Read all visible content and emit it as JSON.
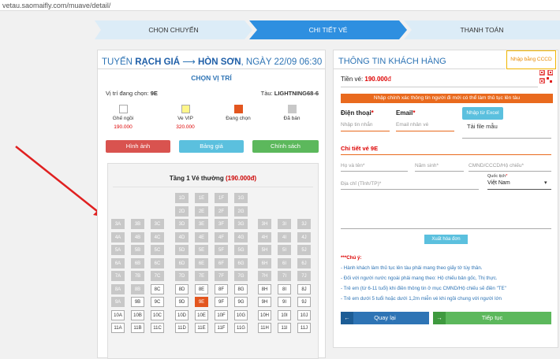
{
  "url": "vetau.saomaifly.com/muave/detail/",
  "steps": [
    "CHỌN CHUYẾN",
    "CHI TIẾT VÉ",
    "THANH TOÁN"
  ],
  "trip": {
    "prefix": "TUYẾN",
    "from": "RẠCH GIÁ",
    "arrow": "⟶",
    "to": "HÒN SƠN",
    "date": ", NGÀY 22/09 06:30"
  },
  "choose_title": "CHỌN VỊ TRÍ",
  "position_label": "Vị trí đang chọn:",
  "position_value": "9E",
  "ship_label": "Tàu:",
  "ship_value": "LIGHTNING68-6",
  "legend": [
    {
      "label": "Ghế ngồi",
      "price": "190.000",
      "color": "#ffffff"
    },
    {
      "label": "Ve VIP",
      "price": "320.000",
      "color": "#fff68a"
    },
    {
      "label": "Đang chọn",
      "price": "",
      "color": "#e3561f"
    },
    {
      "label": "Đã bán",
      "price": "",
      "color": "#c8c8c8"
    }
  ],
  "buttons": [
    {
      "label": "Hình ảnh",
      "color": "#d9534f"
    },
    {
      "label": "Bảng giá",
      "color": "#5bc0de"
    },
    {
      "label": "Chính sách",
      "color": "#5cb85c"
    }
  ],
  "deck_title": "Tầng 1 Vé thường",
  "deck_price": "(190.000đ)",
  "deck_close": "",
  "seats": [
    [
      null,
      null,
      null,
      "1D",
      "1E",
      "1F",
      "1G",
      null,
      null,
      null
    ],
    [
      null,
      null,
      null,
      "2D",
      "2E",
      "2F",
      "2G",
      null,
      null,
      null
    ],
    [
      "3A",
      "3B",
      "3C",
      "3D",
      "3E",
      "3F",
      "3G",
      "3H",
      "3I",
      "3J"
    ],
    [
      "4A",
      "4B",
      "4C",
      "4D",
      "4E",
      "4F",
      "4G",
      "4H",
      "4I",
      "4J"
    ],
    [
      "5A",
      "5B",
      "5C",
      "5D",
      "5E",
      "5F",
      "5G",
      "5H",
      "5I",
      "5J"
    ],
    [
      "6A",
      "6B",
      "6C",
      "6D",
      "6E",
      "6F",
      "6G",
      "6H",
      "6I",
      "6J"
    ],
    [
      "7A",
      "7B",
      "7C",
      "7D",
      "7E",
      "7F",
      "7G",
      "7H",
      "7I",
      "7J"
    ],
    [
      "8A",
      "8B",
      "8C",
      "8D",
      "8E",
      "8F",
      "8G",
      "8H",
      "8I",
      "8J"
    ],
    [
      "9A",
      "9B",
      "9C",
      "9D",
      "9E",
      "9F",
      "9G",
      "9H",
      "9I",
      "9J"
    ],
    [
      "10A",
      "10B",
      "10C",
      "10D",
      "10E",
      "10F",
      "10G",
      "10H",
      "10I",
      "10J"
    ],
    [
      "11A",
      "11B",
      "11C",
      "11D",
      "11E",
      "11F",
      "11G",
      "11H",
      "11I",
      "11J"
    ]
  ],
  "seat_status": [
    [
      null,
      null,
      null,
      "s",
      "s",
      "s",
      "s",
      null,
      null,
      null
    ],
    [
      null,
      null,
      null,
      "s",
      "s",
      "s",
      "s",
      null,
      null,
      null
    ],
    [
      "s",
      "s",
      "s",
      "s",
      "s",
      "s",
      "s",
      "s",
      "s",
      "s"
    ],
    [
      "s",
      "s",
      "s",
      "s",
      "s",
      "s",
      "s",
      "s",
      "s",
      "s"
    ],
    [
      "s",
      "s",
      "s",
      "s",
      "s",
      "s",
      "s",
      "s",
      "s",
      "s"
    ],
    [
      "s",
      "s",
      "s",
      "s",
      "s",
      "s",
      "s",
      "s",
      "s",
      "s"
    ],
    [
      "s",
      "s",
      "s",
      "s",
      "s",
      "s",
      "s",
      "s",
      "s",
      "s"
    ],
    [
      "s",
      "s",
      "a",
      "a",
      "a",
      "a",
      "a",
      "a",
      "a",
      "a"
    ],
    [
      "s",
      "a",
      "a",
      "a",
      "x",
      "a",
      "a",
      "a",
      "a",
      "a"
    ],
    [
      "a",
      "a",
      "a",
      "a",
      "a",
      "a",
      "a",
      "a",
      "a",
      "a"
    ],
    [
      "a",
      "a",
      "a",
      "a",
      "a",
      "a",
      "a",
      "a",
      "a",
      "a"
    ]
  ],
  "right": {
    "title": "THÔNG TIN KHÁCH HÀNG",
    "cccd_label": "Nhập bằng CCCD",
    "fare_label": "Tiền vé:",
    "fare_value": "190.000",
    "fare_unit": "đ",
    "warning": "Nhập chính xác thông tin người đi mới có thể làm thủ tục lên tàu",
    "phone_label": "Điện thoại",
    "phone_placeholder": "Nhập tin nhắn",
    "email_label": "Email",
    "email_placeholder": "Email nhân vé",
    "excel_label": "Nhập từ Excel",
    "template_label": "Tải file mẫu",
    "detail_label": "Chi tiết vé 9E",
    "name_placeholder": "Họ và tên*",
    "birth_placeholder": "Năm sinh*",
    "id_placeholder": "CMND/CCCD/Hộ chiếu*",
    "address_placeholder": "Địa chỉ (Tỉnh/TP)*",
    "nationality_label": "Quốc tịch",
    "nationality_value": "Việt Nam",
    "invoice_label": "Xuất hóa đơn",
    "note_title": "***Chú ý:",
    "notes": [
      "- Hành khách làm thủ tục lên tàu phải mang theo giấy tờ tùy thân.",
      "- Đối với người nước ngoài phải mang theo: Hộ chiếu bản gốc, Thị thực.",
      "- Trẻ em (từ 6-11 tuổi) khi điền thông tin ở mục CMND/Hộ chiếu sẽ điền \"TE\"",
      "- Trẻ em dưới 5 tuổi hoặc dưới 1,2m miễn vé khi ngồi chung với người lớn"
    ],
    "back_label": "Quay lại",
    "next_label": "Tiếp tục"
  }
}
